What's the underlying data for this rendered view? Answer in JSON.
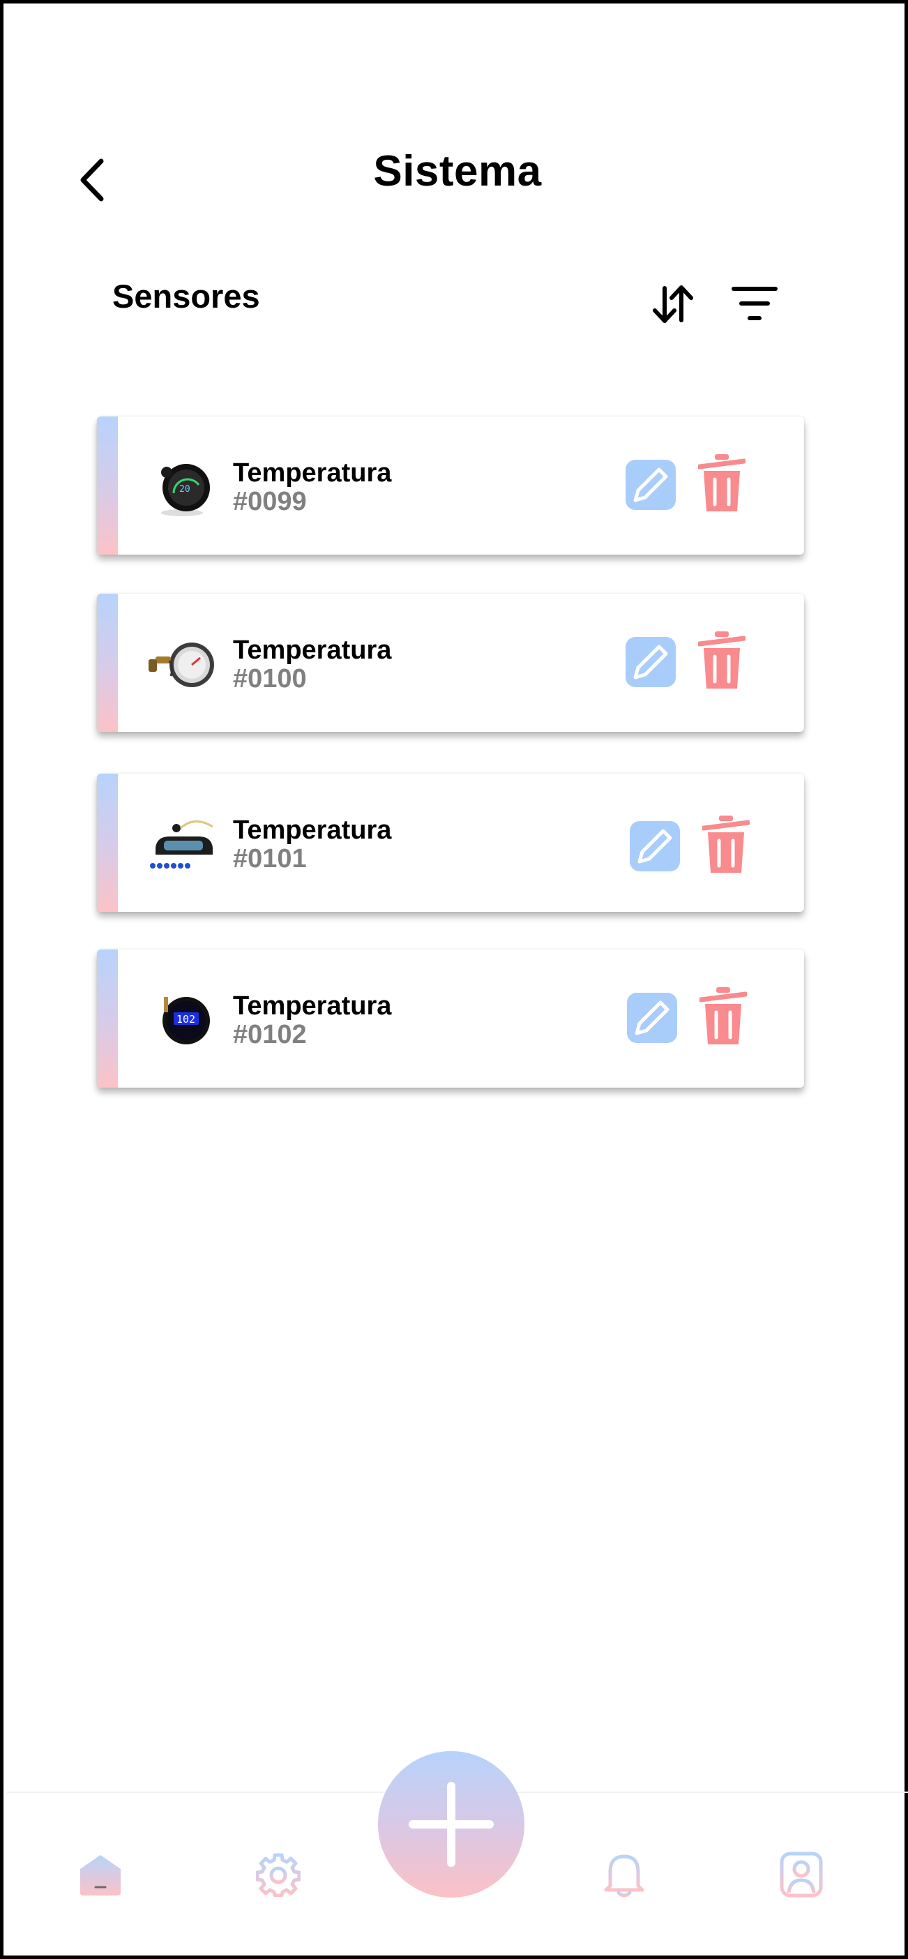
{
  "header": {
    "title": "Sistema",
    "back_icon": "chevron-left-icon"
  },
  "toolbar": {
    "section_label": "Sensores",
    "sort_icon": "sort-arrows-icon",
    "filter_icon": "filter-lines-icon"
  },
  "sensors": [
    {
      "name": "Temperatura",
      "id": "#0099"
    },
    {
      "name": "Temperatura",
      "id": "#0100"
    },
    {
      "name": "Temperatura",
      "id": "#0101"
    },
    {
      "name": "Temperatura",
      "id": "#0102"
    }
  ],
  "bottom_nav": {
    "items": [
      "home-icon",
      "gear-icon",
      "add-icon",
      "bell-icon",
      "profile-icon"
    ]
  },
  "colors": {
    "accent_blue": "#b7d3fb",
    "accent_pink": "#fcc2c7",
    "edit_blue": "#a9cdfb",
    "delete_red": "#f98a8d",
    "id_gray": "#808080"
  }
}
